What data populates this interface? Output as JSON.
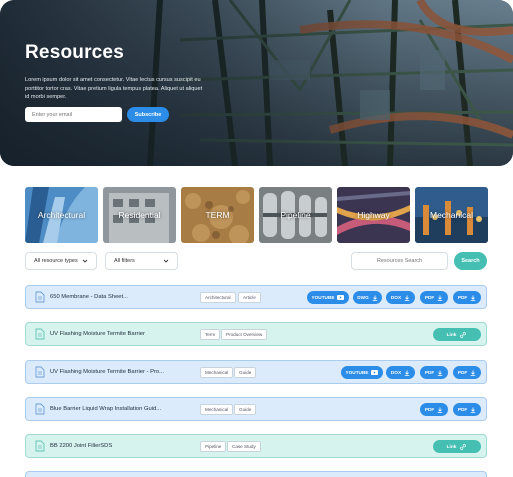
{
  "hero": {
    "title": "Resources",
    "description": "Lorem ipsum dolor sit amet consectetur. Vitae lectus cursus suscipit eu porttitor tortor cras. Vitae pretium ligula tempus platea. Aliquet ut aliquet id morbi semper.",
    "email_placeholder": "Enter your email",
    "subscribe_label": "Subscribe"
  },
  "categories": [
    {
      "label": "Architectural",
      "icon": "architectural-image"
    },
    {
      "label": "Residential",
      "icon": "residential-image"
    },
    {
      "label": "TERM",
      "icon": "term-image"
    },
    {
      "label": "Pipeline",
      "icon": "pipeline-image"
    },
    {
      "label": "Highway",
      "icon": "highway-image"
    },
    {
      "label": "Mechanical",
      "icon": "mechanical-image"
    }
  ],
  "filters": {
    "resource_types": "All resource types",
    "filters": "All filters",
    "search_placeholder": "Resources Search",
    "search_label": "Search"
  },
  "resources": [
    {
      "title": "650 Membrane - Data Sheet...",
      "tags": [
        "Architectural",
        "Article"
      ],
      "actions": [
        "YOUTUBE",
        "DWG",
        "DOX",
        "PDF",
        "PDF"
      ]
    },
    {
      "title": "UV Flashing Moisture Termite Barrier",
      "tags": [
        "Term",
        "Product Overview"
      ],
      "actions": [
        "Link"
      ]
    },
    {
      "title": "UV Flashing Moisture Termite Barrier - Pro...",
      "tags": [
        "Mechanical",
        "Guide"
      ],
      "actions": [
        "YOUTUBE",
        "DOX",
        "PDF",
        "PDF"
      ]
    },
    {
      "title": "Blue Barrier Liquid Wrap Installation Guid...",
      "tags": [
        "Mechanical",
        "Guide"
      ],
      "actions": [
        "PDF",
        "PDF"
      ]
    },
    {
      "title": "BB 2200 Joint FillerSDS",
      "tags": [
        "Pipeline",
        "Case Study"
      ],
      "actions": [
        "Link"
      ]
    }
  ],
  "colors": {
    "accent_blue": "#2b8de8",
    "accent_teal": "#45bfb2",
    "row_blue": "#dcebfb",
    "row_teal": "#d7f3ee"
  }
}
